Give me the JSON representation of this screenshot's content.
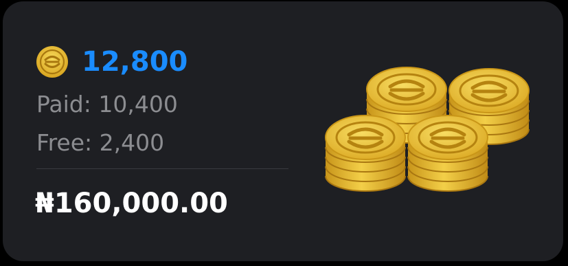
{
  "wallet": {
    "currency_icon": "coin-icon",
    "total_coins": "12,800",
    "paid_label": "Paid: 10,400",
    "free_label": "Free: 2,400",
    "price": "₦160,000.00",
    "illustration": "coin-stacks-icon"
  },
  "colors": {
    "card_background": "#1e1f23",
    "accent_blue": "#1a8cff",
    "muted_text": "#8c8d91",
    "price_text": "#ffffff",
    "coin_gold": "#e3b52e"
  }
}
